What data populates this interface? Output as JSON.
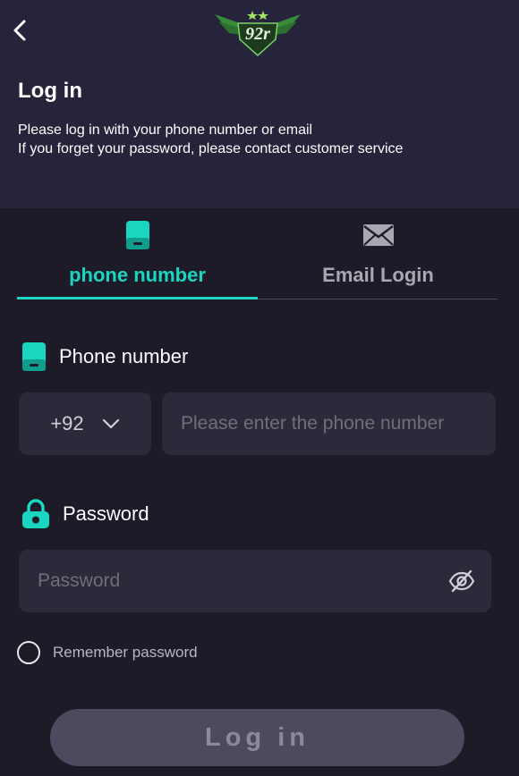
{
  "header": {
    "logo_text": "92r",
    "title": "Log in",
    "description_lines": [
      "Please log in with your phone number or email",
      "If you forget your password, please contact customer service"
    ]
  },
  "tabs": [
    {
      "label": "phone number",
      "icon": "phone-icon",
      "active": true
    },
    {
      "label": "Email Login",
      "icon": "mail-icon",
      "active": false
    }
  ],
  "phone_field": {
    "label": "Phone number",
    "icon": "phone-icon",
    "country_code": "+92",
    "placeholder": "Please enter the phone number"
  },
  "password_field": {
    "label": "Password",
    "icon": "lock-icon",
    "placeholder": "Password"
  },
  "remember": {
    "label": "Remember password",
    "checked": false
  },
  "login_button": {
    "label": "Log in"
  },
  "colors": {
    "accent": "#1ad6c0",
    "background": "#1c1b27",
    "header_background": "#25243a",
    "input_background": "#2a2a3a",
    "button_background": "#4b4a5e"
  }
}
